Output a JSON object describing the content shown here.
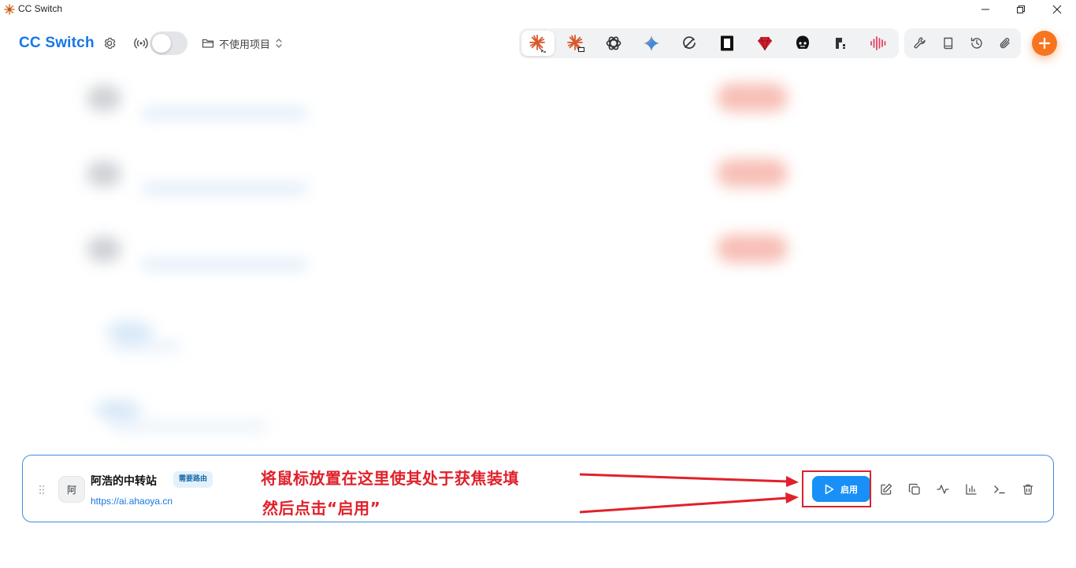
{
  "window": {
    "title": "CC Switch",
    "controls": [
      "minimize",
      "restore",
      "close"
    ]
  },
  "header": {
    "brand": "CC Switch",
    "proxy_toggle": {
      "on": false
    },
    "project_select": {
      "value": "不使用项目"
    },
    "app_tabs": [
      {
        "name": "claude-code",
        "active": true
      },
      {
        "name": "claude-desktop",
        "active": false
      },
      {
        "name": "openai-codex",
        "active": false
      },
      {
        "name": "gemini",
        "active": false
      },
      {
        "name": "opencode",
        "active": false
      },
      {
        "name": "cursor",
        "active": false
      },
      {
        "name": "red-gem",
        "active": false
      },
      {
        "name": "character",
        "active": false
      },
      {
        "name": "pixel-app",
        "active": false
      },
      {
        "name": "audio-wave",
        "active": false
      }
    ],
    "tools": [
      "wrench-icon",
      "book-icon",
      "history-icon",
      "paperclip-icon"
    ]
  },
  "provider": {
    "avatar_text": "阿",
    "name": "阿浩的中转站",
    "badge": "需要路由",
    "url": "https://ai.ahaoya.cn",
    "enable_label": "启用",
    "actions": [
      "edit-icon",
      "copy-icon",
      "pulse-icon",
      "chart-icon",
      "terminal-icon",
      "trash-icon"
    ]
  },
  "annotation": {
    "line1": "将鼠标放置在这里使其处于获焦装填",
    "line2": "然后点击“启用”"
  },
  "colors": {
    "brand": "#1677e6",
    "accent_orange": "#f7751f",
    "enable_button": "#1890f7",
    "annotation_red": "#e0212b"
  }
}
